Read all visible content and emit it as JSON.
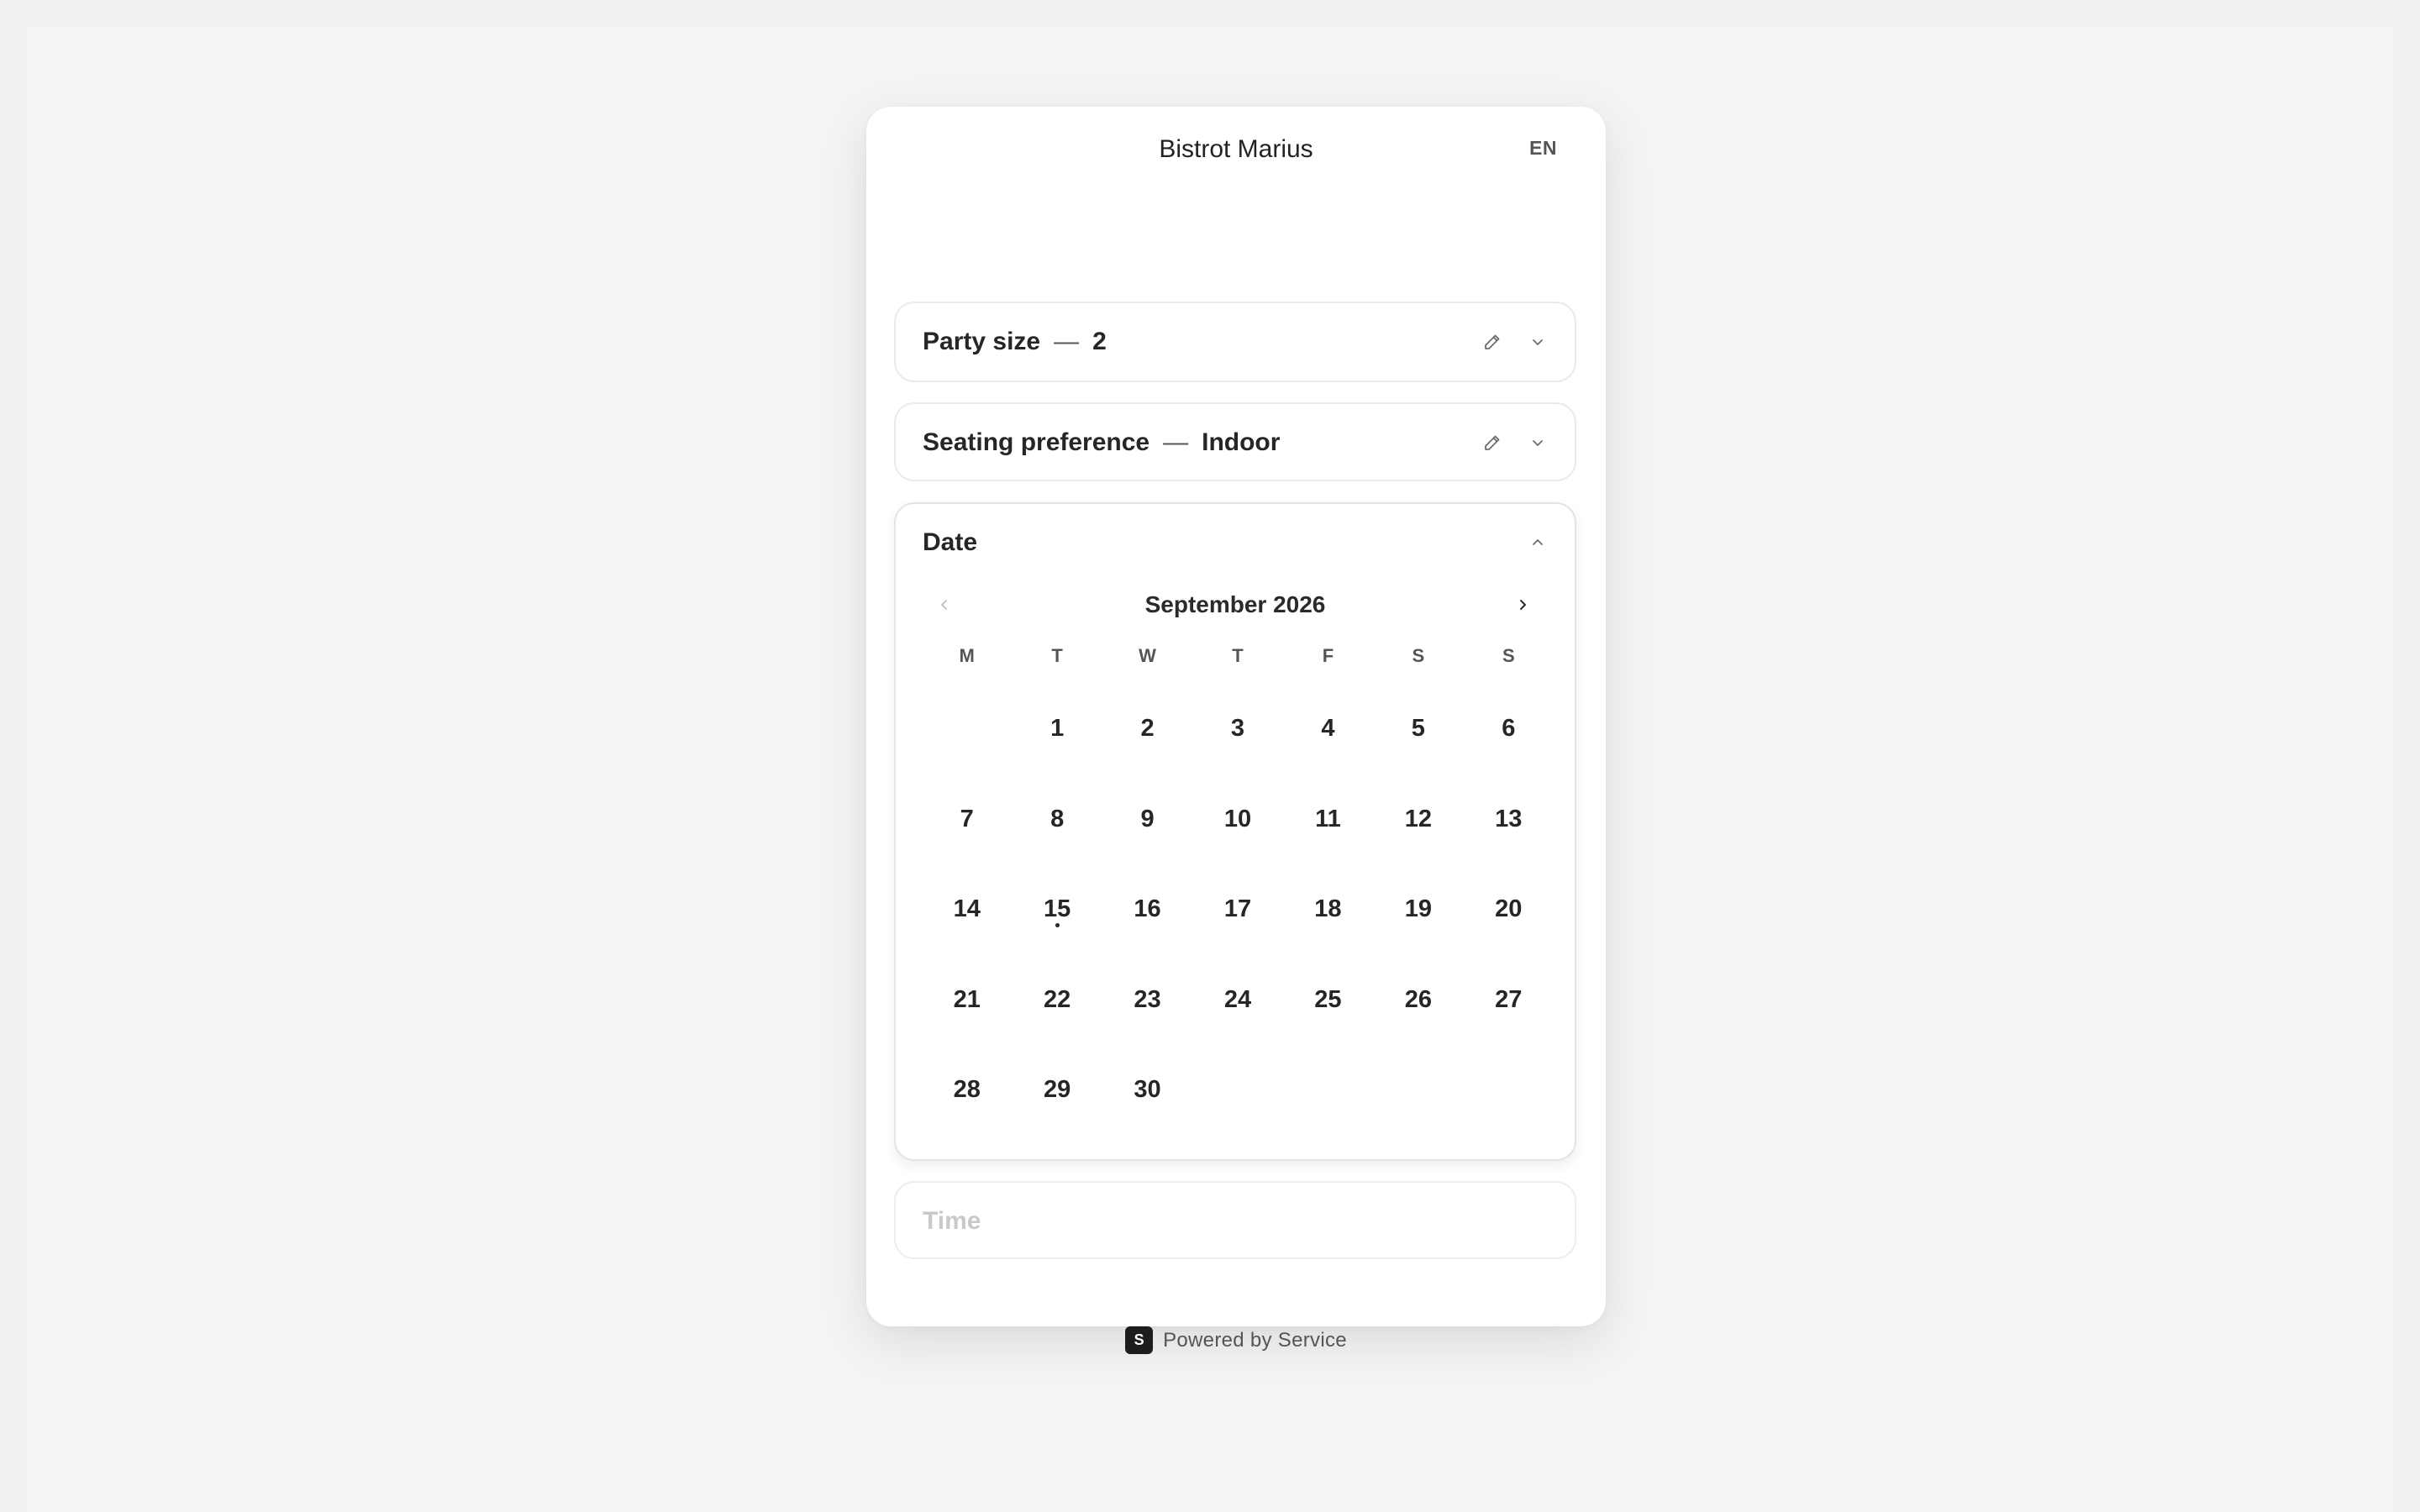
{
  "header": {
    "title": "Bistrot Marius",
    "language": "EN"
  },
  "party": {
    "label": "Party size",
    "separator": "—",
    "value": "2"
  },
  "seating": {
    "label": "Seating preference",
    "separator": "—",
    "value": "Indoor"
  },
  "date": {
    "label": "Date",
    "month_title": "September 2026",
    "weekdays": [
      "M",
      "T",
      "W",
      "T",
      "F",
      "S",
      "S"
    ],
    "leading_blanks": 1,
    "days": [
      "1",
      "2",
      "3",
      "4",
      "5",
      "6",
      "7",
      "8",
      "9",
      "10",
      "11",
      "12",
      "13",
      "14",
      "15",
      "16",
      "17",
      "18",
      "19",
      "20",
      "21",
      "22",
      "23",
      "24",
      "25",
      "26",
      "27",
      "28",
      "29",
      "30"
    ],
    "today": "15"
  },
  "time": {
    "label": "Time"
  },
  "footer": {
    "brand_letter": "S",
    "text": "Powered by Service"
  },
  "icons": {
    "edit": "pencil-icon",
    "expand": "chevron-down-icon",
    "collapse": "chevron-up-icon",
    "prev": "chevron-left-icon",
    "next": "chevron-right-icon"
  },
  "colors": {
    "background": "#f4f4f4",
    "card": "#ffffff",
    "text": "#262626",
    "muted": "#c9c9c9"
  }
}
